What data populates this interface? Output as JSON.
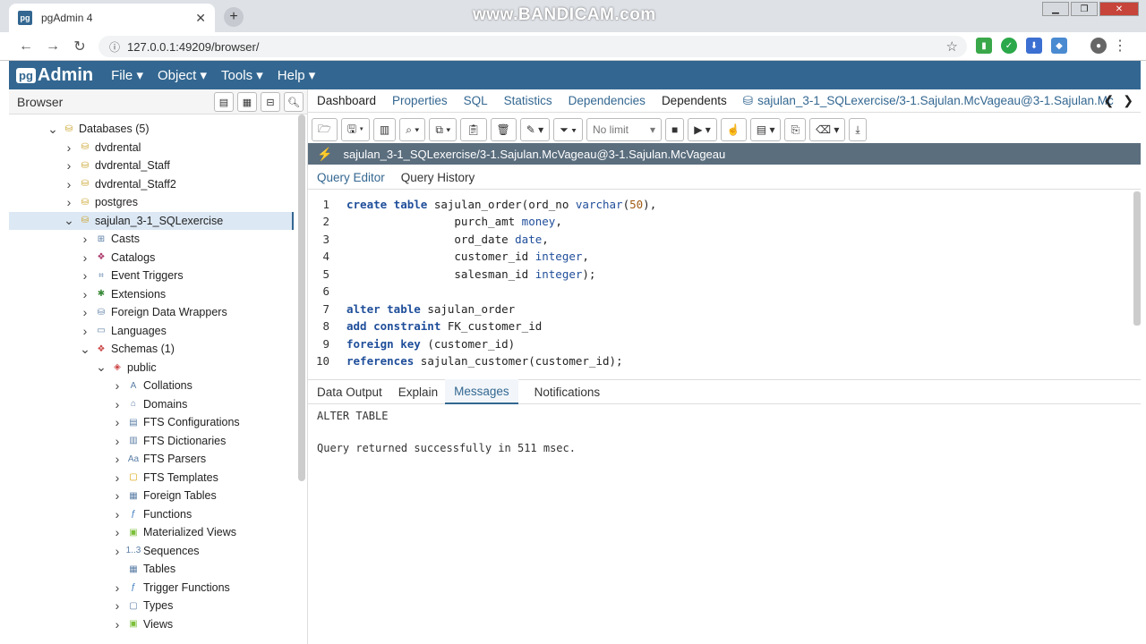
{
  "browser": {
    "tab_title": "pgAdmin 4",
    "favicon_text": "pg",
    "url": "127.0.0.1:49209/browser/",
    "watermark": "www.BANDICAM.com"
  },
  "app": {
    "logo_prefix": "pg",
    "logo_text": "Admin",
    "menus": [
      "File",
      "Object",
      "Tools",
      "Help"
    ]
  },
  "sidebar": {
    "title": "Browser",
    "tree": [
      {
        "label": "Databases (5)",
        "level": 0,
        "chev": "v",
        "icon": "database-group-icon"
      },
      {
        "label": "dvdrental",
        "level": 1,
        "chev": ">",
        "icon": "database-icon"
      },
      {
        "label": "dvdrental_Staff",
        "level": 1,
        "chev": ">",
        "icon": "database-icon"
      },
      {
        "label": "dvdrental_Staff2",
        "level": 1,
        "chev": ">",
        "icon": "database-icon"
      },
      {
        "label": "postgres",
        "level": 1,
        "chev": ">",
        "icon": "database-icon"
      },
      {
        "label": "sajulan_3-1_SQLexercise",
        "level": 1,
        "chev": "v",
        "icon": "database-icon",
        "selected": true
      },
      {
        "label": "Casts",
        "level": 2,
        "chev": ">",
        "icon": "casts-icon"
      },
      {
        "label": "Catalogs",
        "level": 2,
        "chev": ">",
        "icon": "catalogs-icon"
      },
      {
        "label": "Event Triggers",
        "level": 2,
        "chev": ">",
        "icon": "event-triggers-icon"
      },
      {
        "label": "Extensions",
        "level": 2,
        "chev": ">",
        "icon": "extensions-icon"
      },
      {
        "label": "Foreign Data Wrappers",
        "level": 2,
        "chev": ">",
        "icon": "fdw-icon"
      },
      {
        "label": "Languages",
        "level": 2,
        "chev": ">",
        "icon": "languages-icon"
      },
      {
        "label": "Schemas (1)",
        "level": 2,
        "chev": "v",
        "icon": "schemas-icon"
      },
      {
        "label": "public",
        "level": 3,
        "chev": "v",
        "icon": "schema-icon"
      },
      {
        "label": "Collations",
        "level": 4,
        "chev": ">",
        "icon": "collations-icon"
      },
      {
        "label": "Domains",
        "level": 4,
        "chev": ">",
        "icon": "domains-icon"
      },
      {
        "label": "FTS Configurations",
        "level": 4,
        "chev": ">",
        "icon": "fts-config-icon"
      },
      {
        "label": "FTS Dictionaries",
        "level": 4,
        "chev": ">",
        "icon": "fts-dict-icon"
      },
      {
        "label": "FTS Parsers",
        "level": 4,
        "chev": ">",
        "icon": "fts-parser-icon"
      },
      {
        "label": "FTS Templates",
        "level": 4,
        "chev": ">",
        "icon": "fts-template-icon"
      },
      {
        "label": "Foreign Tables",
        "level": 4,
        "chev": ">",
        "icon": "foreign-table-icon"
      },
      {
        "label": "Functions",
        "level": 4,
        "chev": ">",
        "icon": "functions-icon"
      },
      {
        "label": "Materialized Views",
        "level": 4,
        "chev": ">",
        "icon": "mat-views-icon"
      },
      {
        "label": "Sequences",
        "level": 4,
        "chev": ">",
        "icon": "sequences-icon"
      },
      {
        "label": "Tables",
        "level": 4,
        "chev": "",
        "icon": "tables-icon"
      },
      {
        "label": "Trigger Functions",
        "level": 4,
        "chev": ">",
        "icon": "trigger-functions-icon"
      },
      {
        "label": "Types",
        "level": 4,
        "chev": ">",
        "icon": "types-icon"
      },
      {
        "label": "Views",
        "level": 4,
        "chev": ">",
        "icon": "views-icon"
      }
    ]
  },
  "main": {
    "tabs": [
      "Dashboard",
      "Properties",
      "SQL",
      "Statistics",
      "Dependencies",
      "Dependents"
    ],
    "query_tab_title": "sajulan_3-1_SQLexercise/3-1.Sajulan.McVageau@3-1.Sajulan.Mc",
    "toolbar": {
      "limit_value": "No limit"
    },
    "connection": "sajulan_3-1_SQLexercise/3-1.Sajulan.McVageau@3-1.Sajulan.McVageau",
    "query_tabs": [
      "Query Editor",
      "Query History"
    ],
    "code_lines": [
      {
        "n": "1",
        "html": "<span class='kw'>create table</span> sajulan_order(ord_no <span class='ty'>varchar</span>(<span class='nm'>50</span>),"
      },
      {
        "n": "2",
        "html": "                purch_amt <span class='ty'>money</span>,"
      },
      {
        "n": "3",
        "html": "                ord_date <span class='ty'>date</span>,"
      },
      {
        "n": "4",
        "html": "                customer_id <span class='ty'>integer</span>,"
      },
      {
        "n": "5",
        "html": "                salesman_id <span class='ty'>integer</span>);"
      },
      {
        "n": "6",
        "html": ""
      },
      {
        "n": "7",
        "html": "<span class='kw'>alter table</span> sajulan_order"
      },
      {
        "n": "8",
        "html": "<span class='kw'>add constraint</span> FK_customer_id"
      },
      {
        "n": "9",
        "html": "<span class='kw'>foreign key</span> (customer_id)"
      },
      {
        "n": "10",
        "html": "<span class='kw'>references</span> sajulan_customer(customer_id);"
      }
    ],
    "output_tabs": [
      "Data Output",
      "Explain",
      "Messages",
      "Notifications"
    ],
    "messages": [
      "ALTER TABLE",
      "",
      "Query returned successfully in 511 msec."
    ]
  }
}
